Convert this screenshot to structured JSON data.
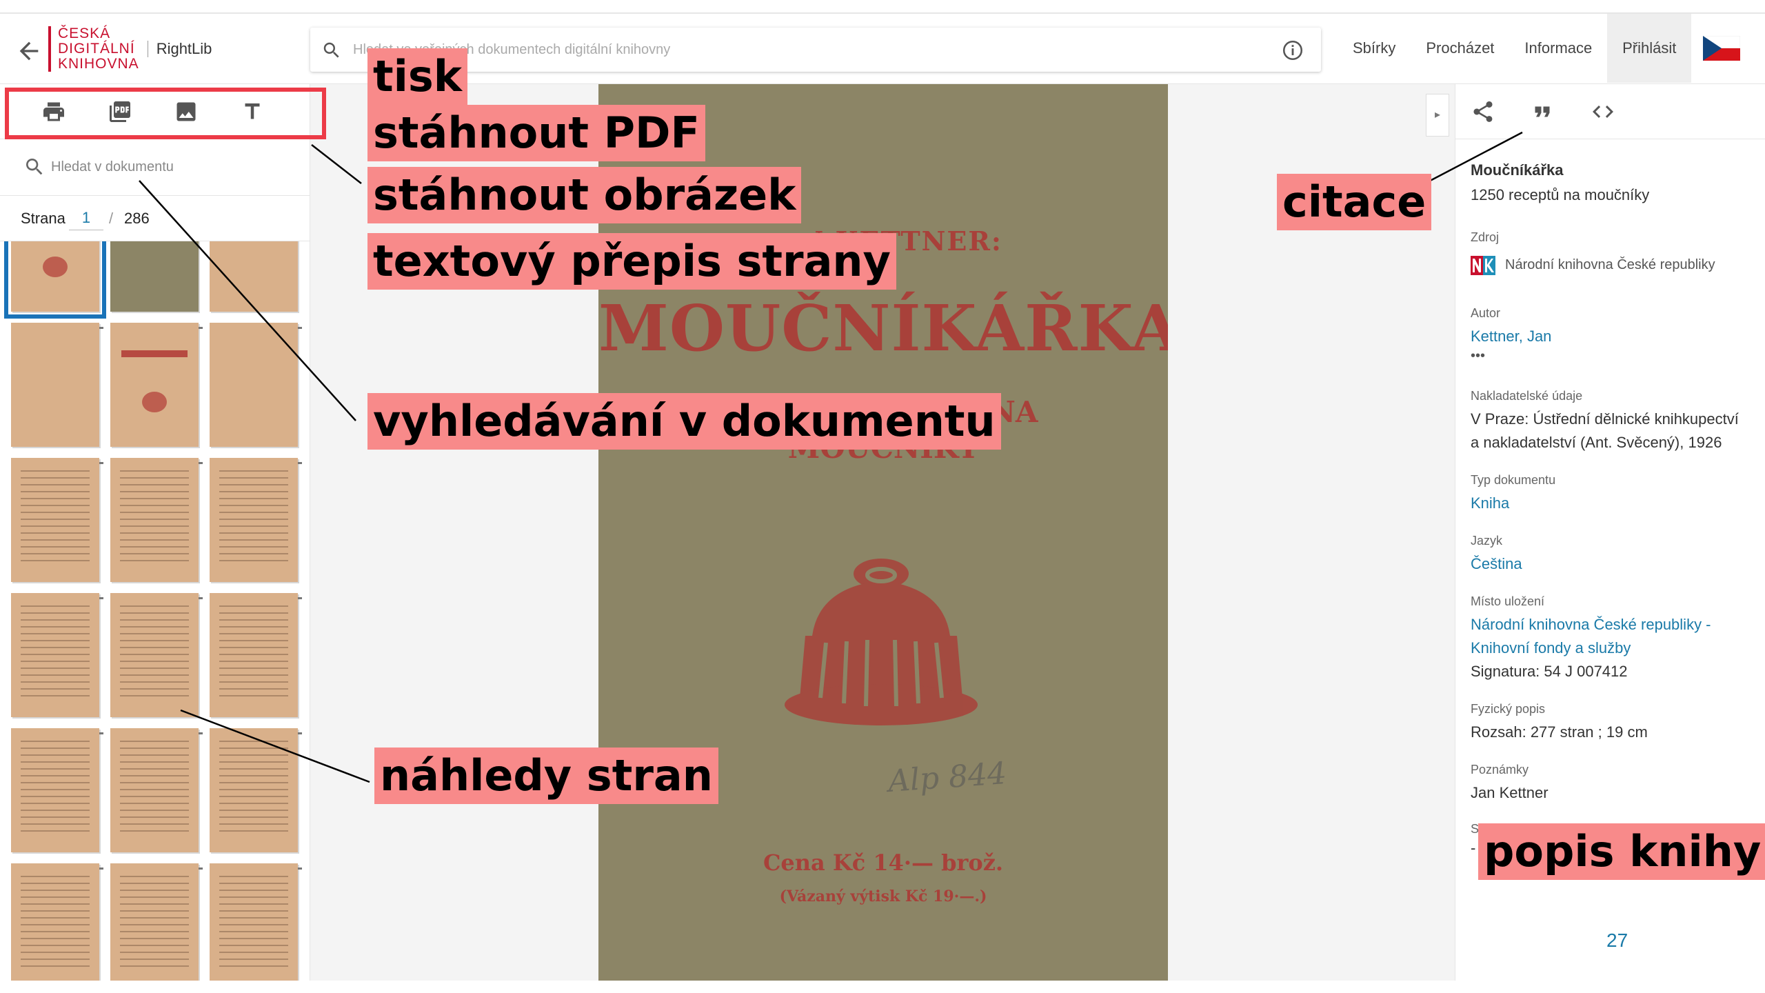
{
  "header": {
    "logo_lines": [
      "ČESKÁ",
      "DIGITÁLNÍ",
      "KNIHOVNA"
    ],
    "library_name": "RightLib",
    "search_placeholder": "Hledat ve veřejných dokumentech digitální knihovny",
    "nav": [
      "Sbírky",
      "Procházet",
      "Informace",
      "Přihlásit"
    ]
  },
  "left_panel": {
    "toolbar_icons": [
      "print-icon",
      "pdf-icon",
      "image-icon",
      "text-icon"
    ],
    "doc_search_placeholder": "Hledat v dokumentu",
    "pager_label": "Strana",
    "current_page": "1",
    "separator": "/",
    "total_pages": "286"
  },
  "page": {
    "author": "JAN KETTNER:",
    "title": "MOUČNÍKÁŘKA",
    "subtitle_1": "1250 RECEPTŮ NA",
    "subtitle_2": "MOUČNÍKY",
    "signature": "Alp 844",
    "price": "Cena Kč 14·— brož.",
    "price_bound": "(Vázaný výtisk Kč 19·—.)"
  },
  "right_panel": {
    "title": "Moučníkářka",
    "subtitle": "1250 receptů na moučníky",
    "source_label": "Zdroj",
    "source_value": "Národní knihovna České republiky",
    "author_label": "Autor",
    "author_value": "Kettner, Jan",
    "more": "•••",
    "publisher_label": "Nakladatelské údaje",
    "publisher_line1": "V Praze: Ústřední dělnické knihkupectví",
    "publisher_line2": "a nakladatelství (Ant. Svěcený), 1926",
    "type_label": "Typ dokumentu",
    "type_value": "Kniha",
    "lang_label": "Jazyk",
    "lang_value": "Čeština",
    "location_label": "Místo uložení",
    "location_line1": "Národní knihovna České republiky -",
    "location_line2": "Knihovní fondy a služby",
    "signature": "Signatura: 54 J 007412",
    "physical_label": "Fyzický popis",
    "physical_value": "Rozsah: 277 stran ; 19 cm",
    "notes_label": "Poznámky",
    "notes_value": "Jan Kettner",
    "partial_label": "S",
    "partial_value": "-"
  },
  "slide_number": "27",
  "annotations": {
    "tisk": "tisk",
    "pdf": "stáhnout PDF",
    "obrazek": "stáhnout obrázek",
    "prepis": "textový přepis strany",
    "vyhledavani": "vyhledávání v dokumentu",
    "nahledy": "náhledy stran",
    "citace": "citace",
    "popis": "popis knihy"
  },
  "colors": {
    "annotation_bg": "#f88a8a",
    "highlight_box": "#ec3b47",
    "link": "#1a7aa8",
    "brand_red": "#c8102e",
    "page_paper": "#8c8566",
    "page_ink": "#a8413a"
  }
}
